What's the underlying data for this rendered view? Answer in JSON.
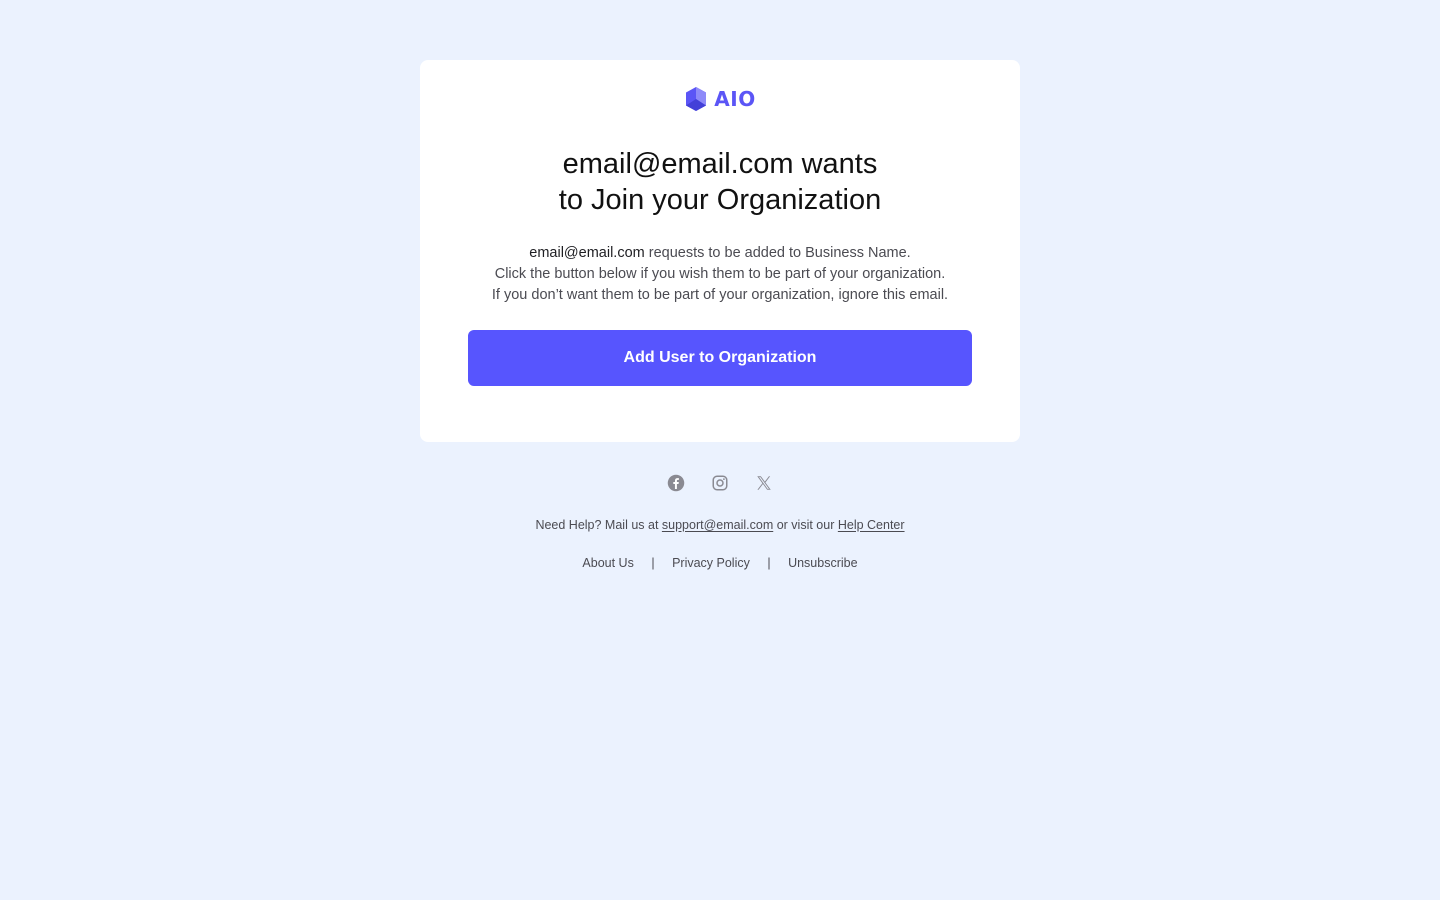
{
  "brand": {
    "name": "AIO",
    "color": "#5b55f6"
  },
  "heading": {
    "line1": "email@email.com wants",
    "line2": "to Join your Organization"
  },
  "message": {
    "requester_email": "email@email.com",
    "line1_rest": " requests to be added to Business Name.",
    "line2": "Click the button below if you wish them to be part of your organization.",
    "line3": "If you don’t want them to be part of your organization, ignore this email."
  },
  "cta": {
    "label": "Add User to Organization",
    "color": "#5755fe"
  },
  "socials": [
    {
      "icon": "facebook-icon"
    },
    {
      "icon": "instagram-icon"
    },
    {
      "icon": "x-twitter-icon"
    }
  ],
  "help": {
    "prefix": "Need Help? Mail us at ",
    "support_email": "support@email.com",
    "middle": " or visit our ",
    "help_center": "Help Center"
  },
  "footer_links": {
    "about": "About Us",
    "privacy": "Privacy Policy",
    "unsubscribe": "Unsubscribe",
    "separator": "|"
  },
  "colors": {
    "page_background": "#ebf2fe",
    "card_background": "#ffffff"
  }
}
